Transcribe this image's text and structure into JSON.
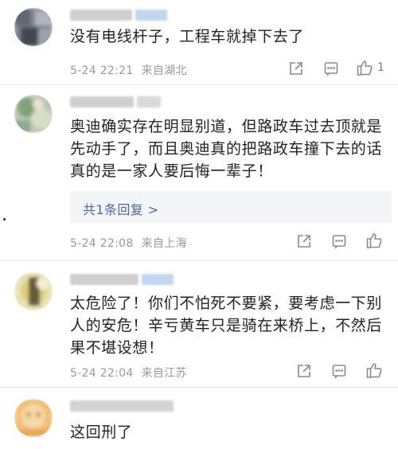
{
  "comments": [
    {
      "text": "没有电线杆子，工程车就掉下去了",
      "time": "5-24 22:21",
      "location": "来自湖北",
      "likes": "1"
    },
    {
      "text": "奥迪确实存在明显别道，但路政车过去顶就是先动手了，而且奥迪真的把路政车撞下去的话真的是一家人要后悔一辈子！",
      "reply_link": "共1条回复 >",
      "time": "5-24 22:08",
      "location": "来自上海",
      "likes": ""
    },
    {
      "text": "太危险了！你们不怕死不要紧，要考虑一下别人的安危！辛亏黄车只是骑在来桥上，不然后果不堪设想！",
      "time": "5-24 22:04",
      "location": "来自江苏",
      "likes": ""
    },
    {
      "text": "这回刑了"
    }
  ],
  "icons": {
    "share": "share-icon",
    "more": "more-icon",
    "like": "thumbs-up-icon"
  },
  "colors": {
    "meta_text": "#999999",
    "reply_link": "#4a6a9c",
    "reply_bg": "#f4f5f7",
    "divider": "#e6e6e6"
  }
}
